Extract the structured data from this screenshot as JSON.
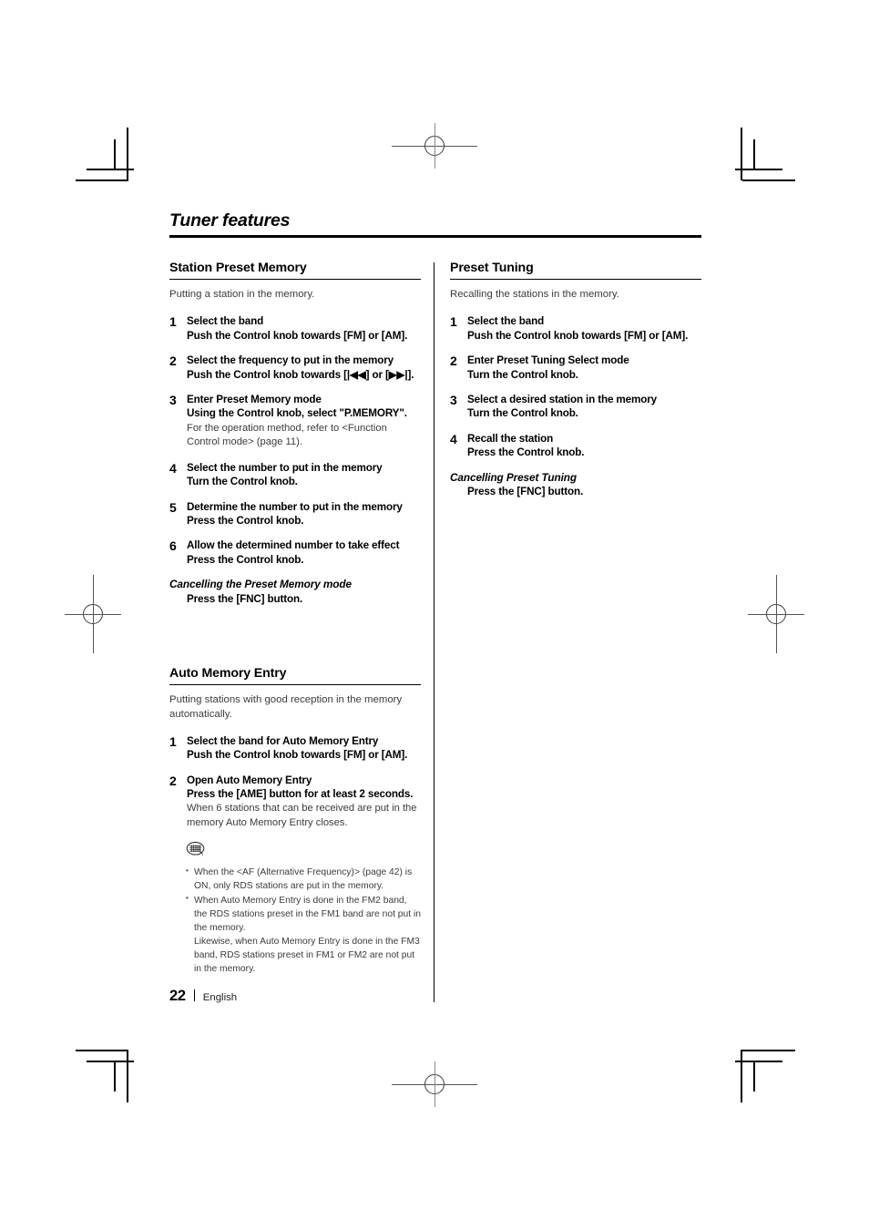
{
  "document": {
    "chapter_title": "Tuner features",
    "footer": {
      "page_number": "22",
      "language": "English"
    }
  },
  "left_column": {
    "sections": [
      {
        "title": "Station Preset Memory",
        "intro": "Putting a station in the memory.",
        "steps": [
          {
            "number": "1",
            "head": "Select the band",
            "sub": "Push the Control knob towards [FM] or [AM].",
            "note": ""
          },
          {
            "number": "2",
            "head": "Select the frequency to put in the memory",
            "sub": "Push the Control knob towards [|◀◀] or [▶▶|].",
            "note": ""
          },
          {
            "number": "3",
            "head": "Enter Preset Memory mode",
            "sub": "Using the Control knob, select \"P.MEMORY\".",
            "note": "For the operation method, refer to <Function Control mode> (page 11)."
          },
          {
            "number": "4",
            "head": "Select the number to put in the memory",
            "sub": "Turn the Control knob.",
            "note": ""
          },
          {
            "number": "5",
            "head": "Determine the number to put in the memory",
            "sub": "Press the Control knob.",
            "note": ""
          },
          {
            "number": "6",
            "head": "Allow the determined number to take effect",
            "sub": "Press the Control knob.",
            "note": ""
          }
        ],
        "cancel": {
          "title": "Cancelling the Preset Memory mode",
          "text": "Press the [FNC] button."
        }
      },
      {
        "title": "Auto Memory Entry",
        "intro": "Putting stations with good reception in the memory automatically.",
        "steps": [
          {
            "number": "1",
            "head": "Select the band for Auto Memory Entry",
            "sub": "Push the Control knob towards [FM] or [AM].",
            "note": ""
          },
          {
            "number": "2",
            "head": "Open Auto Memory Entry",
            "sub": "Press the [AME] button for at least 2 seconds.",
            "note": "When 6 stations that can be received are put in the memory Auto Memory Entry closes."
          }
        ],
        "note_icon": "note-speech-bubble-icon",
        "notes": [
          {
            "text": "When the <AF (Alternative Frequency)> (page 42) is ON, only RDS stations are put in the memory.",
            "continuation": ""
          },
          {
            "text": "When Auto Memory Entry is done in the FM2 band, the RDS stations preset in the FM1 band are not put in the memory.",
            "continuation": "Likewise, when Auto Memory Entry is done in the FM3 band, RDS stations preset in FM1 or FM2 are not put in the memory."
          }
        ]
      }
    ]
  },
  "right_column": {
    "sections": [
      {
        "title": "Preset Tuning",
        "intro": "Recalling the stations in the memory.",
        "steps": [
          {
            "number": "1",
            "head": "Select the band",
            "sub": "Push the Control knob towards [FM] or [AM].",
            "note": ""
          },
          {
            "number": "2",
            "head": "Enter Preset Tuning Select mode",
            "sub": "Turn the Control knob.",
            "note": ""
          },
          {
            "number": "3",
            "head": "Select a desired station in the memory",
            "sub": "Turn the Control knob.",
            "note": ""
          },
          {
            "number": "4",
            "head": "Recall the station",
            "sub": "Press the Control knob.",
            "note": ""
          }
        ],
        "cancel": {
          "title": "Cancelling Preset Tuning",
          "text": "Press the [FNC] button."
        }
      }
    ]
  },
  "colors": {
    "ink": "#000000",
    "body_text": "#3b3b3b",
    "registration_mark": "#555555"
  }
}
